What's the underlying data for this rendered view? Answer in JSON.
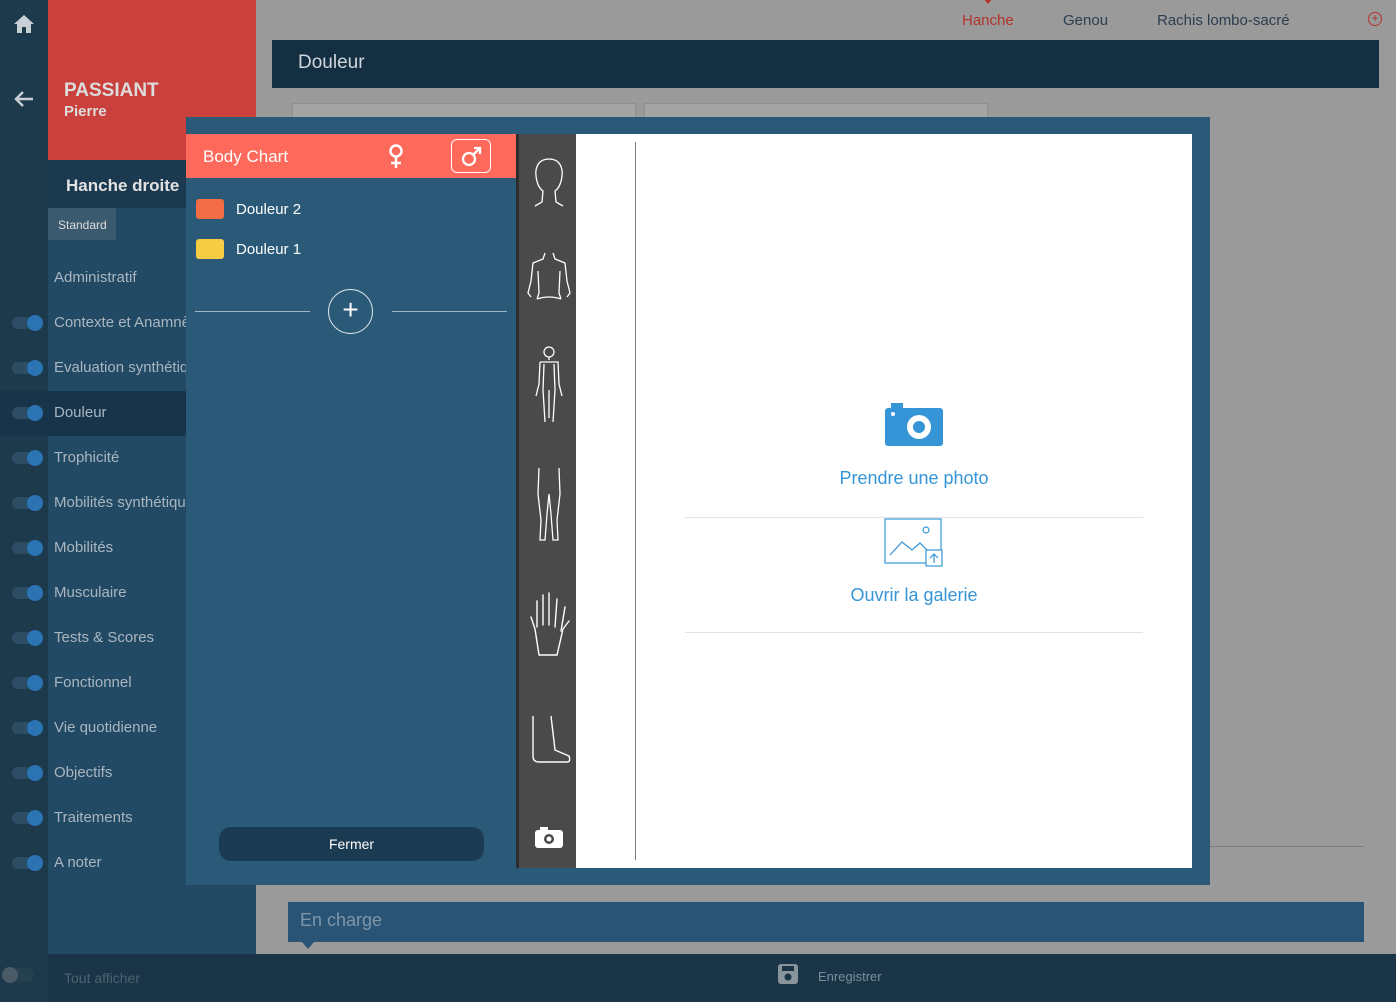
{
  "patient": {
    "last_name": "PASSIANT",
    "first_name": "Pierre"
  },
  "section": {
    "title": "Hanche droite",
    "tab": "Standard"
  },
  "nav_items": [
    {
      "label": "Administratif",
      "toggle": false,
      "active": false
    },
    {
      "label": "Contexte et Anamnèse",
      "toggle": true,
      "active": false
    },
    {
      "label": "Evaluation synthétique",
      "toggle": true,
      "active": false
    },
    {
      "label": "Douleur",
      "toggle": true,
      "active": true
    },
    {
      "label": "Trophicité",
      "toggle": true,
      "active": false
    },
    {
      "label": "Mobilités synthétiques",
      "toggle": true,
      "active": false
    },
    {
      "label": "Mobilités",
      "toggle": true,
      "active": false
    },
    {
      "label": "Musculaire",
      "toggle": true,
      "active": false
    },
    {
      "label": "Tests & Scores",
      "toggle": true,
      "active": false
    },
    {
      "label": "Fonctionnel",
      "toggle": true,
      "active": false
    },
    {
      "label": "Vie quotidienne",
      "toggle": true,
      "active": false
    },
    {
      "label": "Objectifs",
      "toggle": true,
      "active": false
    },
    {
      "label": "Traitements",
      "toggle": true,
      "active": false
    },
    {
      "label": "A noter",
      "toggle": true,
      "active": false
    }
  ],
  "top_tabs": [
    {
      "label": "Hanche",
      "active": true
    },
    {
      "label": "Genou",
      "active": false
    },
    {
      "label": "Rachis lombo-sacré",
      "active": false
    }
  ],
  "main": {
    "section_header": "Douleur",
    "footer_section": "En charge"
  },
  "bottom_bar": {
    "show_all": "Tout afficher",
    "save": "Enregistrer"
  },
  "modal": {
    "title": "Body Chart",
    "pains": [
      {
        "label": "Douleur 2",
        "color": "#f26d45"
      },
      {
        "label": "Douleur 1",
        "color": "#f7cd45"
      }
    ],
    "add_symbol": "+",
    "close_label": "Fermer",
    "tools": [
      "head-icon",
      "torso-icon",
      "full-body-icon",
      "legs-icon",
      "hand-icon",
      "foot-icon",
      "camera-icon"
    ],
    "take_photo": "Prendre une photo",
    "open_gallery": "Ouvrir la galerie"
  },
  "colors": {
    "accent_red": "#fd6a5b",
    "modal_blue": "#2b5a79",
    "link_blue": "#3595d6",
    "dark_navy": "#142f42"
  }
}
